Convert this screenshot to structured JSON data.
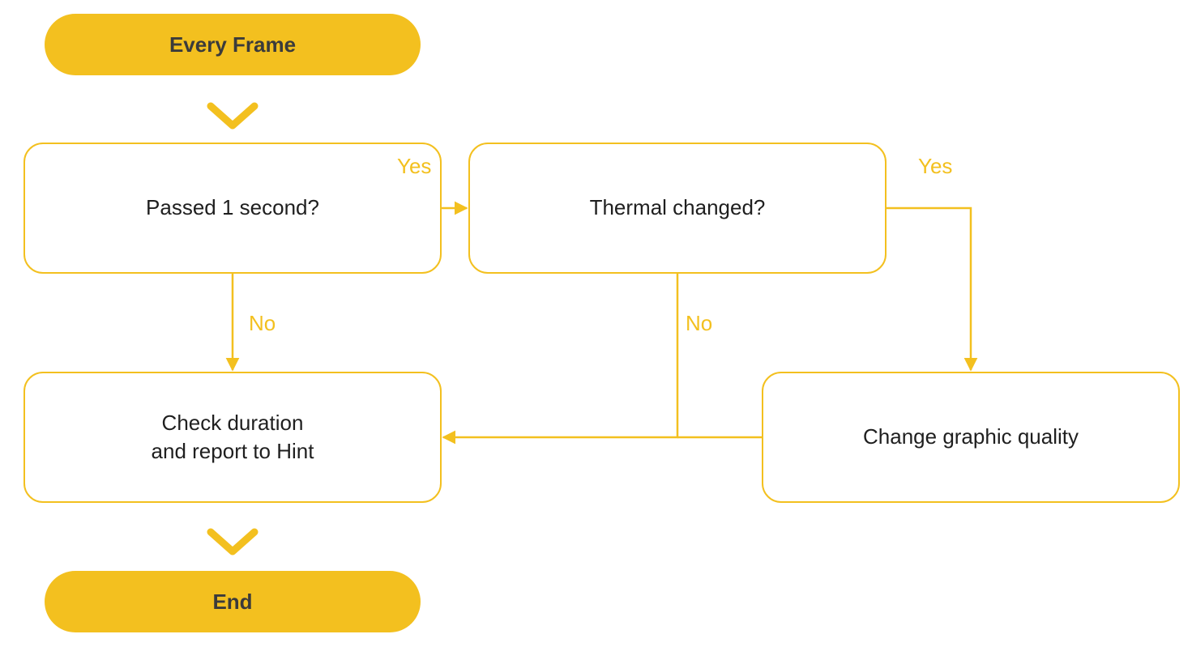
{
  "colors": {
    "accent": "#f3c01f",
    "text_dark": "#3b3b3b",
    "text_body": "#1f1f1f"
  },
  "nodes": {
    "start": {
      "label": "Every Frame"
    },
    "d1": {
      "label": "Passed 1 second?"
    },
    "d2": {
      "label": "Thermal changed?"
    },
    "p1_l1": "Check duration",
    "p1_l2": "and report to Hint",
    "p2": {
      "label": "Change graphic quality"
    },
    "end": {
      "label": "End"
    }
  },
  "edges": {
    "d1_yes": "Yes",
    "d1_no": "No",
    "d2_yes": "Yes",
    "d2_no": "No"
  }
}
